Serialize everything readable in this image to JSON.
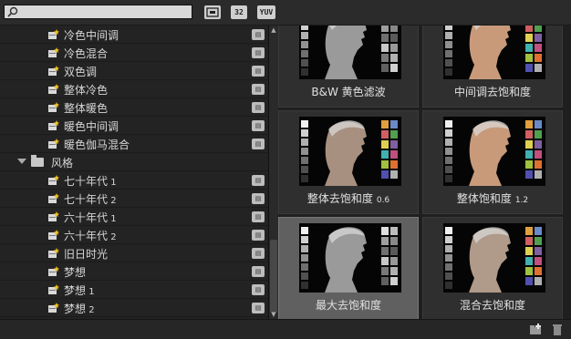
{
  "toolbar": {
    "search": {
      "placeholder": "",
      "value": ""
    },
    "buttons": [
      {
        "name": "accelerated-effects-filter-button",
        "icon": "film-icon",
        "label": ""
      },
      {
        "name": "32bit-filter-button",
        "icon": "32-icon",
        "label": "32"
      },
      {
        "name": "yuv-filter-button",
        "icon": "yuv-icon",
        "label": "YUV"
      }
    ]
  },
  "tree": [
    {
      "kind": "effect",
      "label": "冷色中间调",
      "num": ""
    },
    {
      "kind": "effect",
      "label": "冷色混合",
      "num": ""
    },
    {
      "kind": "effect",
      "label": "双色调",
      "num": ""
    },
    {
      "kind": "effect",
      "label": "整体冷色",
      "num": ""
    },
    {
      "kind": "effect",
      "label": "整体暖色",
      "num": ""
    },
    {
      "kind": "effect",
      "label": "暖色中间调",
      "num": ""
    },
    {
      "kind": "effect",
      "label": "暖色伽马混合",
      "num": ""
    },
    {
      "kind": "folder",
      "label": "风格",
      "num": ""
    },
    {
      "kind": "effect",
      "label": "七十年代",
      "num": "1"
    },
    {
      "kind": "effect",
      "label": "七十年代",
      "num": "2"
    },
    {
      "kind": "effect",
      "label": "六十年代",
      "num": "1"
    },
    {
      "kind": "effect",
      "label": "六十年代",
      "num": "2"
    },
    {
      "kind": "effect",
      "label": "旧日时光",
      "num": ""
    },
    {
      "kind": "effect",
      "label": "梦想",
      "num": ""
    },
    {
      "kind": "effect",
      "label": "梦想",
      "num": "1"
    },
    {
      "kind": "effect",
      "label": "梦想",
      "num": "2"
    }
  ],
  "tiles": [
    {
      "label": "B&W 黄色滤波",
      "value": "",
      "tone": "bw",
      "selected": false
    },
    {
      "label": "中间调去饱和度",
      "value": "",
      "tone": "warm",
      "selected": false
    },
    {
      "label": "整体去饱和度",
      "value": "0.6",
      "tone": "muted",
      "selected": false
    },
    {
      "label": "整体饱和度",
      "value": "1.2",
      "tone": "warm",
      "selected": false
    },
    {
      "label": "最大去饱和度",
      "value": "",
      "tone": "bw",
      "selected": true
    },
    {
      "label": "混合去饱和度",
      "value": "",
      "tone": "mixed",
      "selected": false
    }
  ],
  "statusbar": {
    "new_bin_icon": "new-bin-icon",
    "delete_icon": "trash-icon"
  },
  "colors": {
    "accent": "#f0c020",
    "selected_tile": "#606060",
    "panel_bg": "#232323"
  }
}
